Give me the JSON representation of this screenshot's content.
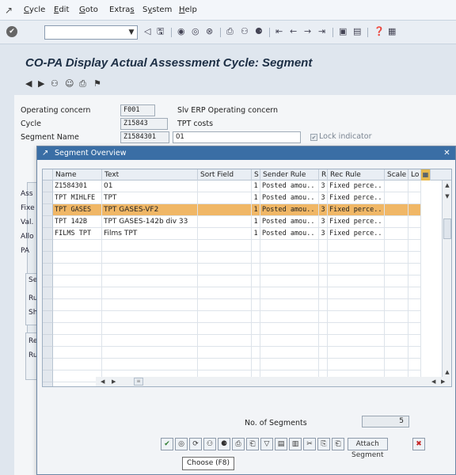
{
  "menubar": {
    "items": [
      "Cycle",
      "Edit",
      "Goto",
      "Extras",
      "System",
      "Help"
    ],
    "underline": [
      "C",
      "E",
      "G",
      "s",
      "y",
      "H"
    ]
  },
  "title": "CO-PA Display Actual Assessment Cycle: Segment",
  "header_fields": [
    {
      "label": "Operating concern",
      "value": "F001",
      "desc": "Slv ERP Operating concern"
    },
    {
      "label": "Cycle",
      "value": "Z15843",
      "desc": "TPT costs"
    },
    {
      "label": "Segment Name",
      "value": "Z1584301",
      "desc": "01"
    }
  ],
  "lock_indicator": "Lock indicator",
  "bg_labels": [
    "Ass",
    "Fixe",
    "Val.",
    "Allo",
    "PA",
    "Se",
    "Ru",
    "Sh",
    "Re",
    "Ru"
  ],
  "popup": {
    "title": "Segment Overview",
    "columns": [
      "Name",
      "Text",
      "Sort Field",
      "S",
      "Sender Rule",
      "R",
      "Rec Rule",
      "Scale",
      "Lo"
    ],
    "rows": [
      {
        "name": "Z1584301",
        "text": "01",
        "sort": "",
        "s": "1",
        "sender": "Posted amou..",
        "r": "3",
        "rec": "Fixed perce..",
        "scale": "",
        "lo": "",
        "selected": false
      },
      {
        "name": "TPT MIHLFE",
        "text": "TPT",
        "sort": "",
        "s": "1",
        "sender": "Posted amou..",
        "r": "3",
        "rec": "Fixed perce..",
        "scale": "",
        "lo": "",
        "selected": false
      },
      {
        "name": "TPT GASES",
        "text": "TPT GASES-VF2",
        "sort": "",
        "s": "1",
        "sender": "Posted amou..",
        "r": "3",
        "rec": "Fixed perce..",
        "scale": "",
        "lo": "",
        "selected": true
      },
      {
        "name": "TPT 142B",
        "text": "TPT GASES-142b div 33",
        "sort": "",
        "s": "1",
        "sender": "Posted amou..",
        "r": "3",
        "rec": "Fixed perce..",
        "scale": "",
        "lo": "",
        "selected": false
      },
      {
        "name": "FILMS TPT",
        "text": "Films TPT",
        "sort": "",
        "s": "1",
        "sender": "Posted amou..",
        "r": "3",
        "rec": "Fixed perce..",
        "scale": "",
        "lo": "",
        "selected": false
      }
    ],
    "segment_count_label": "No. of Segments",
    "segment_count": "5",
    "attach_button": "Attach Segment",
    "tooltip": "Choose  (F8)"
  }
}
